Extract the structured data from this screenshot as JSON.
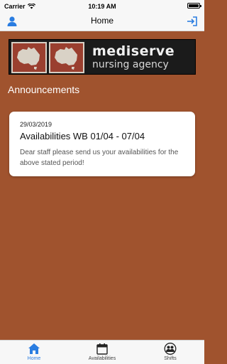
{
  "status_bar": {
    "carrier": "Carrier",
    "time": "10:19 AM"
  },
  "nav": {
    "title": "Home",
    "left_icon": "user-icon",
    "right_icon": "logout-icon",
    "accent": "#2a7de1"
  },
  "banner": {
    "title": "mediserve",
    "subtitle": "nursing agency"
  },
  "announcements": {
    "heading": "Announcements",
    "items": [
      {
        "date": "29/03/2019",
        "title": "Availabilities WB 01/04 - 07/04",
        "body": "Dear staff please send us your availabilities for the above stated period!"
      }
    ]
  },
  "tabs": [
    {
      "label": "Home",
      "icon": "home-icon",
      "active": true
    },
    {
      "label": "Availabilities",
      "icon": "calendar-icon",
      "active": false
    },
    {
      "label": "Shifts",
      "icon": "group-icon",
      "active": false
    }
  ],
  "colors": {
    "background": "#a0532e",
    "active_tab": "#2a7de1"
  }
}
